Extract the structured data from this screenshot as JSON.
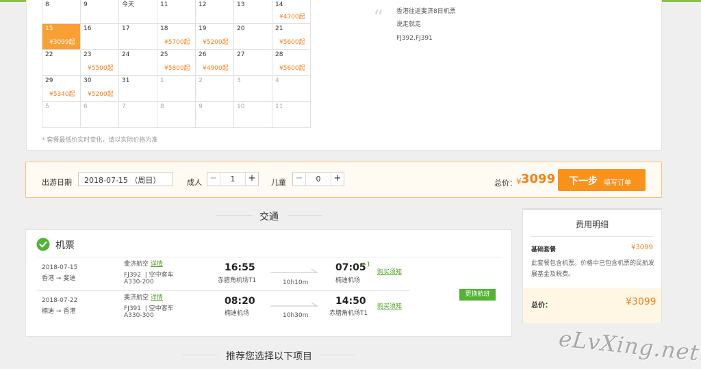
{
  "calendar": {
    "rows": [
      [
        {
          "d": "8",
          "p": ""
        },
        {
          "d": "9",
          "p": ""
        },
        {
          "d": "今天",
          "p": ""
        },
        {
          "d": "11",
          "p": ""
        },
        {
          "d": "12",
          "p": ""
        },
        {
          "d": "13",
          "p": ""
        },
        {
          "d": "14",
          "p": "¥4700起"
        }
      ],
      [
        {
          "d": "15",
          "p": "¥3099起",
          "sel": true
        },
        {
          "d": "16",
          "p": ""
        },
        {
          "d": "17",
          "p": ""
        },
        {
          "d": "18",
          "p": "¥5700起"
        },
        {
          "d": "19",
          "p": "¥5200起"
        },
        {
          "d": "20",
          "p": ""
        },
        {
          "d": "21",
          "p": "¥5600起"
        }
      ],
      [
        {
          "d": "22",
          "p": ""
        },
        {
          "d": "23",
          "p": "¥5500起"
        },
        {
          "d": "24",
          "p": ""
        },
        {
          "d": "25",
          "p": "¥5800起"
        },
        {
          "d": "26",
          "p": "¥4900起"
        },
        {
          "d": "27",
          "p": ""
        },
        {
          "d": "28",
          "p": "¥5600起"
        }
      ],
      [
        {
          "d": "29",
          "p": "¥5340起"
        },
        {
          "d": "30",
          "p": "¥5200起"
        },
        {
          "d": "31",
          "p": ""
        },
        {
          "d": "1",
          "p": "",
          "muted": true
        },
        {
          "d": "2",
          "p": "",
          "muted": true
        },
        {
          "d": "3",
          "p": "",
          "muted": true
        },
        {
          "d": "4",
          "p": "",
          "muted": true
        }
      ],
      [
        {
          "d": "5",
          "p": "",
          "muted": true
        },
        {
          "d": "6",
          "p": "",
          "muted": true
        },
        {
          "d": "7",
          "p": "",
          "muted": true
        },
        {
          "d": "8",
          "p": "",
          "muted": true
        },
        {
          "d": "9",
          "p": "",
          "muted": true
        },
        {
          "d": "10",
          "p": "",
          "muted": true
        },
        {
          "d": "11",
          "p": "",
          "muted": true
        }
      ]
    ],
    "note": "* 套餐最低价实时变化，请以实际价格为准"
  },
  "product": {
    "line1": "香港往返斐济8日机票",
    "line2": "说走就走",
    "line3": "FJ392,FJ391"
  },
  "order": {
    "date_label": "出游日期",
    "date_value": "2018-07-15 （周日）",
    "adult_label": "成人",
    "adult_count": "1",
    "child_label": "儿童",
    "child_count": "0",
    "minus": "−",
    "plus": "+",
    "total_label": "总价：",
    "currency": "¥",
    "total_amount": "3099",
    "next_label": "下一步",
    "next_sub": "填写订单"
  },
  "sections": {
    "transport": "交通",
    "recommend": "推荐您选择以下项目"
  },
  "transport": {
    "header": "机票",
    "flights": [
      {
        "date": "2018-07-15",
        "route_from": "香港",
        "route_arrow": "→",
        "route_to": "斐迪",
        "airline": "斐济航空",
        "detail": "详情",
        "code": "FJ392",
        "sep": "|",
        "class": "空中客车",
        "aircraft": "A330-200",
        "dep_time": "16:55",
        "dep_airport": "赤腊角机场T1",
        "duration": "10h10m",
        "arr_time": "07:05",
        "arr_plus": "+1",
        "arr_airport": "楠迪机场",
        "notice": "购买须知"
      },
      {
        "date": "2018-07-22",
        "route_from": "楠迪",
        "route_arrow": "→",
        "route_to": "香港",
        "airline": "斐济航空",
        "detail": "详情",
        "code": "FJ391",
        "sep": "|",
        "class": "空中客车",
        "aircraft": "A330-300",
        "dep_time": "08:20",
        "dep_airport": "楠迪机场",
        "duration": "10h30m",
        "arr_time": "14:50",
        "arr_plus": "",
        "arr_airport": "赤腊角机场T1",
        "notice": "购买须知"
      }
    ],
    "change_button": "更换航班"
  },
  "fee": {
    "title": "费用明细",
    "basic_label": "基础套餐",
    "basic_price": "¥3099",
    "desc": "此套餐包含机票。价格中已包含机票的民航发展基金及税费。",
    "total_label": "总价：",
    "total_price": "¥3099"
  },
  "watermark": "eLvXing.net",
  "colors": {
    "accent": "#f8921b",
    "price": "#f67f1b",
    "green": "#52b335"
  }
}
